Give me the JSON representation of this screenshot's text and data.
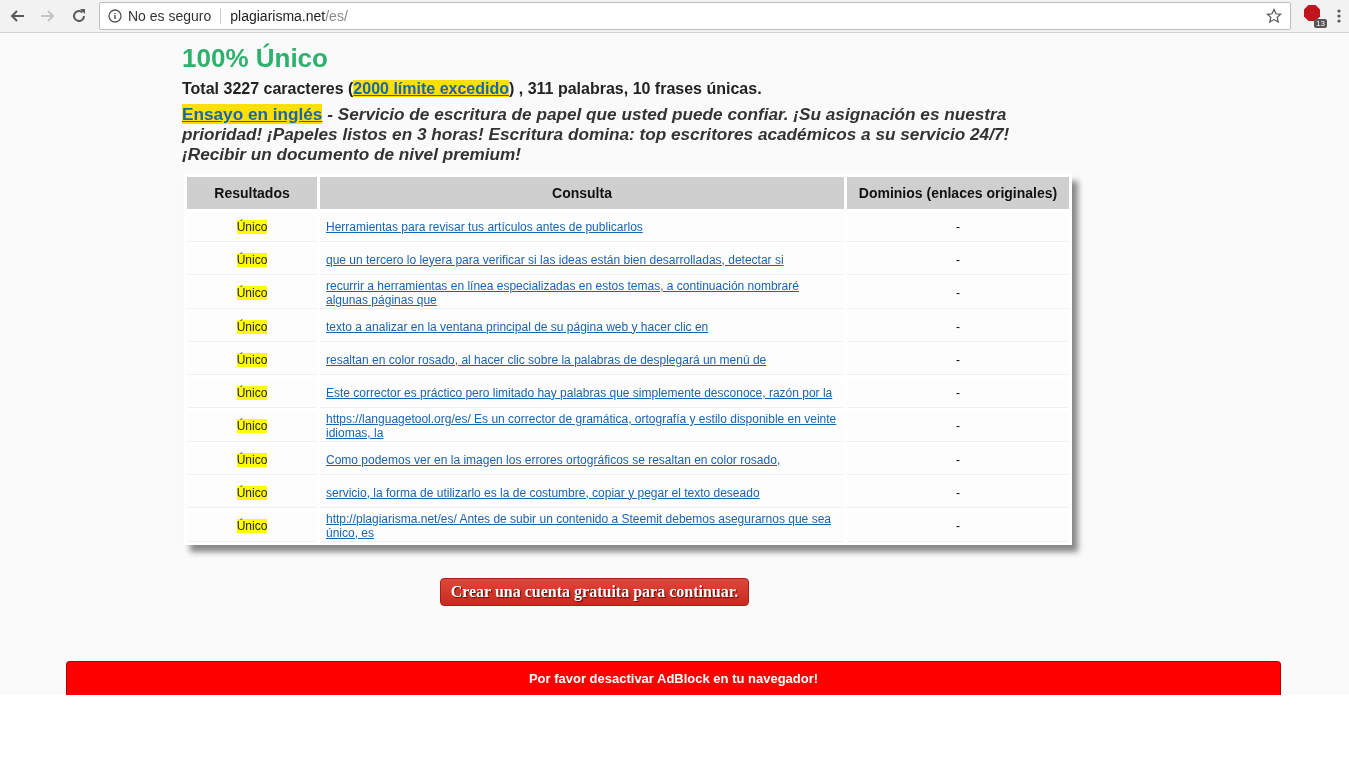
{
  "browser": {
    "security_label": "No es seguro",
    "url_host": "plagiarisma.net",
    "url_path": "/es/",
    "extension_badge": "13"
  },
  "result_title": "100% Único",
  "summary": {
    "before": "Total 3227 caracteres (",
    "link": "2000 límite excedido",
    "after": ") , 311 palabras, 10 frases únicas."
  },
  "promo": {
    "link": "Ensayo en inglés",
    "text": " - Servicio de escritura de papel que usted puede confiar. ¡Su asignación es nuestra prioridad! ¡Papeles listos en 3 horas! Escritura domina: top escritores académicos a su servicio 24/7! ¡Recibir un documento de nivel premium!"
  },
  "table": {
    "columns": [
      "Resultados",
      "Consulta",
      "Dominios (enlaces originales)"
    ],
    "rows": [
      {
        "result": "Único",
        "query": "Herramientas para revisar tus artículos antes de publicarlos",
        "domain": "-"
      },
      {
        "result": "Único",
        "query": "que un tercero lo leyera para verificar si las ideas están bien desarrolladas, detectar si",
        "domain": "-"
      },
      {
        "result": "Único",
        "query": "recurrir a herramientas en línea especializadas en estos temas, a continuación nombraré algunas páginas que",
        "domain": "-"
      },
      {
        "result": "Único",
        "query": "texto a analizar en la ventana principal de su página web y hacer clic en",
        "domain": "-"
      },
      {
        "result": "Único",
        "query": "resaltan en color rosado, al hacer clic sobre la palabras de desplegará un menú de",
        "domain": "-"
      },
      {
        "result": "Único",
        "query": "Este corrector es práctico pero limitado hay palabras que simplemente desconoce, razón por la",
        "domain": "-"
      },
      {
        "result": "Único",
        "query": "https://languagetool.org/es/ Es un corrector de gramática, ortografía y estilo disponible en veinte idiomas, la",
        "domain": "-"
      },
      {
        "result": "Único",
        "query": "Como podemos ver en la imagen los errores ortográficos se resaltan en color rosado,",
        "domain": "-"
      },
      {
        "result": "Único",
        "query": "servicio, la forma de utilizarlo es la de costumbre, copiar y pegar el texto deseado",
        "domain": "-"
      },
      {
        "result": "Único",
        "query": "http://plagiarisma.net/es/ Antes de subir un contenido a Steemit debemos asegurarnos que sea único, es",
        "domain": "-"
      }
    ]
  },
  "signup_button": "Crear una cuenta gratuita para continuar.",
  "adblock_banner": "Por favor desactivar AdBlock en tu navegador!"
}
